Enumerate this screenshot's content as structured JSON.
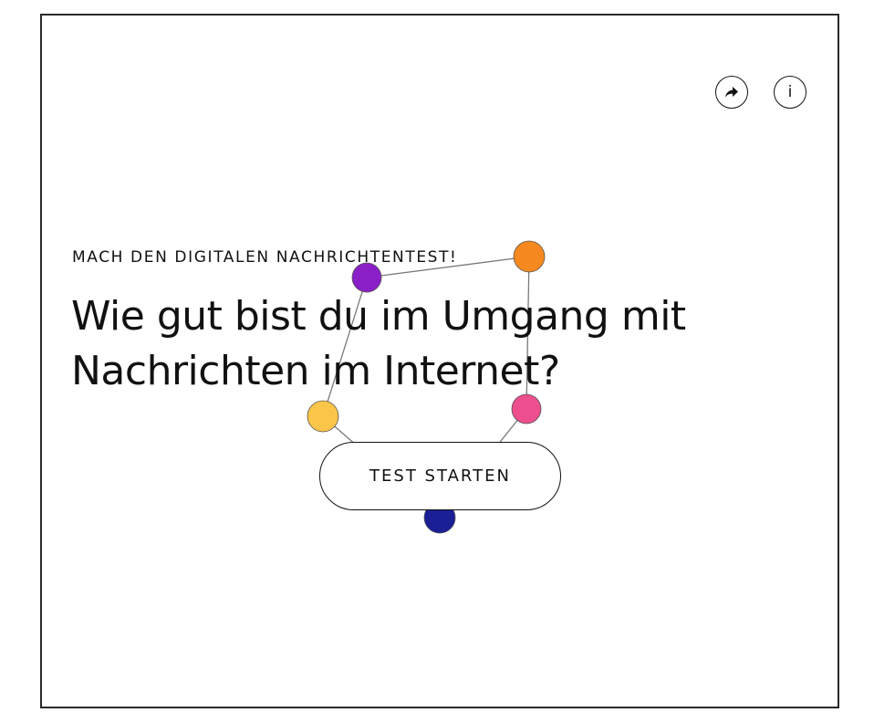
{
  "header": {
    "share_icon": "share-arrow-icon",
    "info_icon": "info-icon",
    "info_glyph": "i"
  },
  "intro": {
    "kicker": "MACH DEN DIGITALEN NACHRICHTENTEST!",
    "headline": "Wie gut bist du im Umgang mit Nachrichten im Internet?"
  },
  "cta": {
    "label": "TEST STARTEN"
  },
  "network": {
    "node_colors": {
      "purple": "#8a1fc7",
      "orange": "#f5891f",
      "yellow": "#fbc54a",
      "pink": "#ec4e8e",
      "navy": "#1a1f96"
    },
    "edge_color": "#7a7a7a"
  }
}
